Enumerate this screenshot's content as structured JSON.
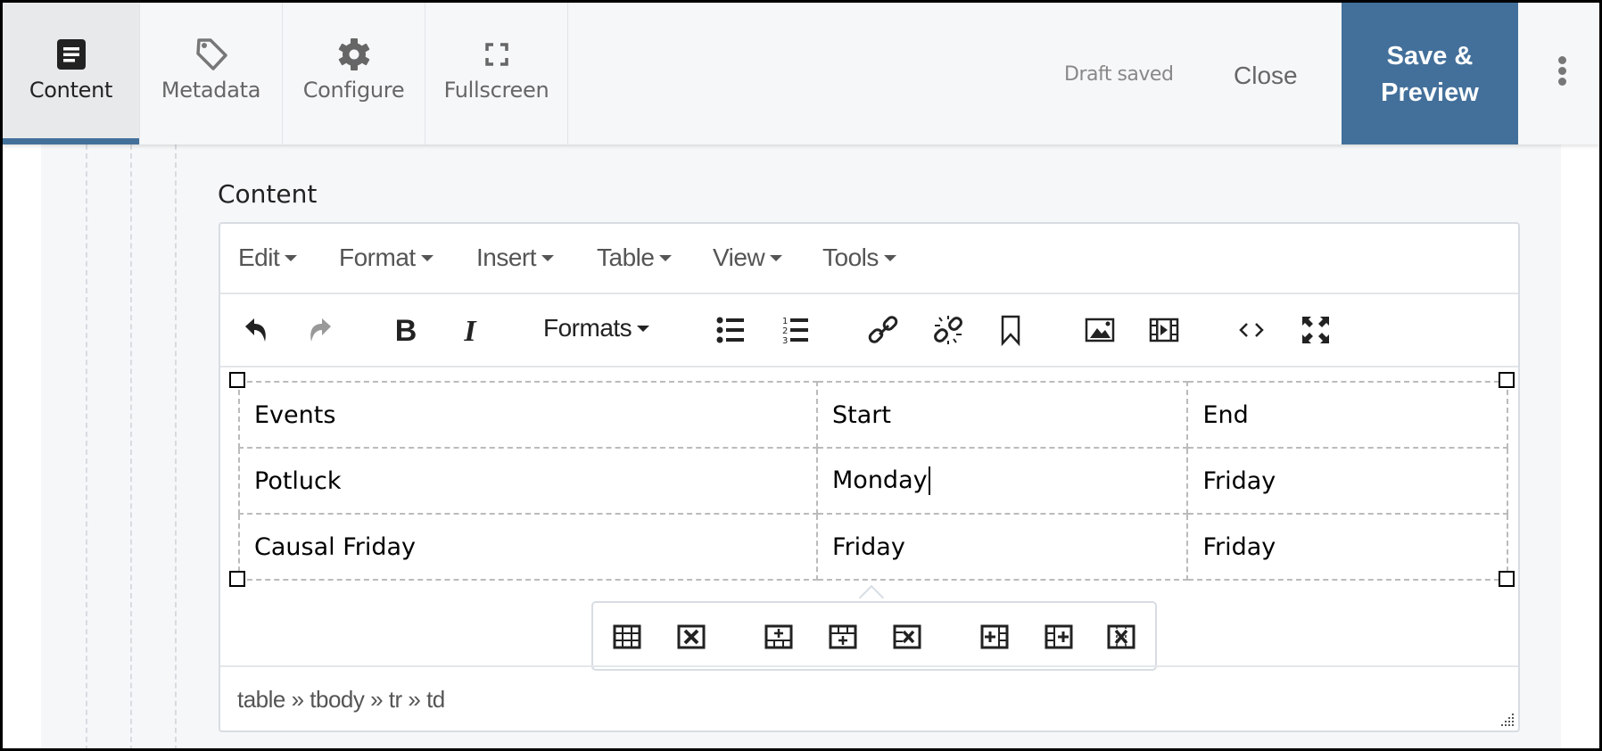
{
  "header": {
    "tabs": [
      {
        "label": "Content",
        "icon": "document-icon",
        "active": true
      },
      {
        "label": "Metadata",
        "icon": "tag-icon",
        "active": false
      },
      {
        "label": "Configure",
        "icon": "gear-icon",
        "active": false
      },
      {
        "label": "Fullscreen",
        "icon": "fullscreen-icon",
        "active": false
      }
    ],
    "status": "Draft saved",
    "close_label": "Close",
    "save_label_line1": "Save &",
    "save_label_line2": "Preview",
    "more_icon": "kebab-menu-icon",
    "accent_color": "#43709a"
  },
  "field": {
    "label": "Content"
  },
  "editor": {
    "menubar": [
      {
        "label": "Edit"
      },
      {
        "label": "Format"
      },
      {
        "label": "Insert"
      },
      {
        "label": "Table"
      },
      {
        "label": "View"
      },
      {
        "label": "Tools"
      }
    ],
    "toolbar": {
      "undo": "undo-icon",
      "redo": "redo-icon",
      "bold": "bold-icon",
      "italic": "italic-icon",
      "formats_label": "Formats",
      "bullet_list": "bullet-list-icon",
      "numbered_list": "numbered-list-icon",
      "link": "link-icon",
      "unlink": "unlink-icon",
      "anchor": "bookmark-icon",
      "image": "image-icon",
      "media": "video-icon",
      "code": "code-icon",
      "fullscreen": "fullscreen-icon"
    },
    "table": {
      "rows": [
        [
          "Events",
          "Start",
          "End"
        ],
        [
          "Potluck",
          "Monday",
          "Friday"
        ],
        [
          "Causal Friday",
          "Friday",
          "Friday"
        ]
      ],
      "cursor_cell": [
        1,
        1
      ]
    },
    "table_popup": [
      "table-properties-icon",
      "delete-table-icon",
      "insert-row-before-icon",
      "insert-row-after-icon",
      "delete-row-icon",
      "insert-column-before-icon",
      "insert-column-after-icon",
      "delete-column-icon"
    ],
    "statusbar_path": "table » tbody » tr » td"
  }
}
